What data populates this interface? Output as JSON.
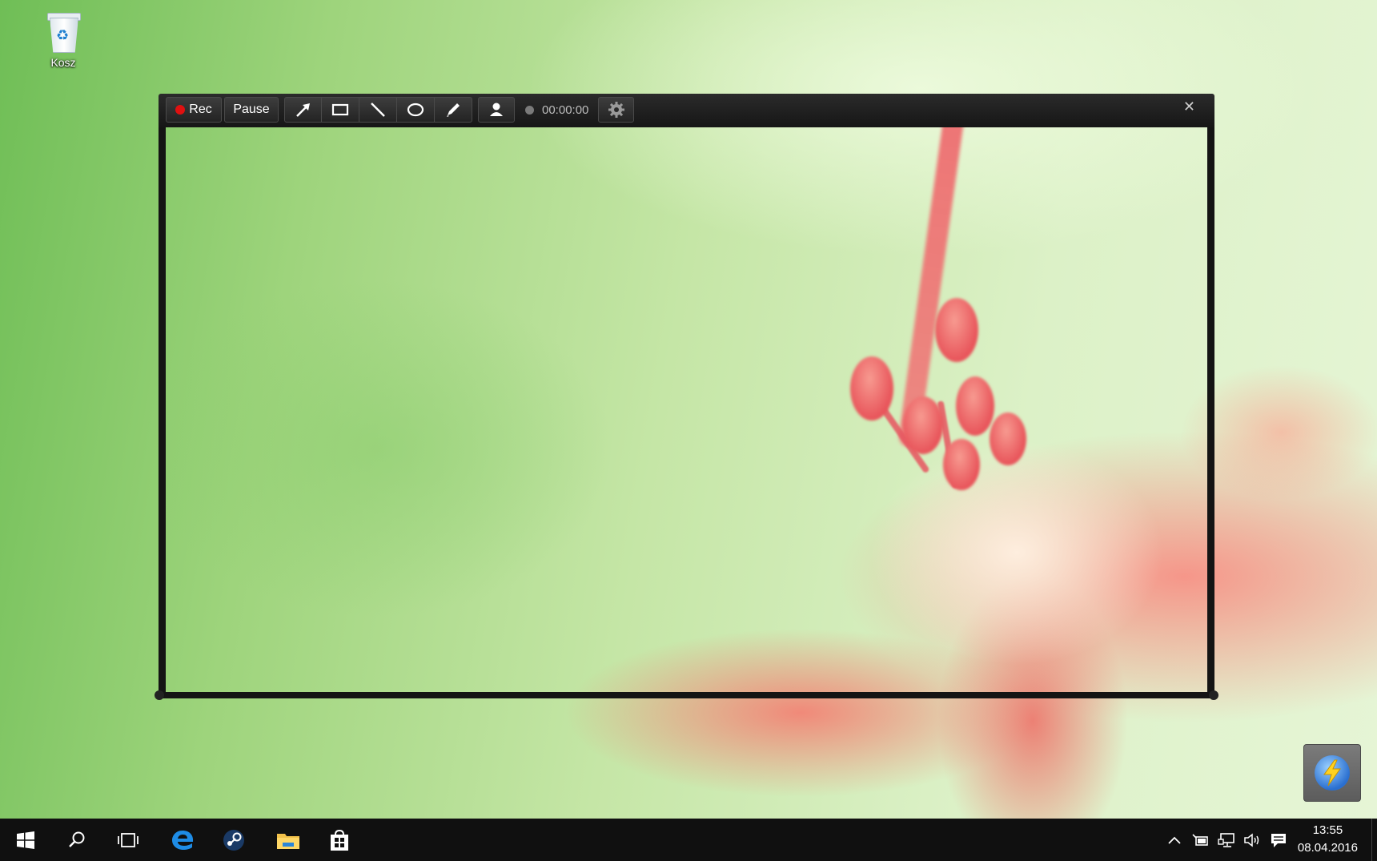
{
  "desktop": {
    "icons": [
      {
        "label": "Kosz",
        "icon": "recycle-bin-icon"
      }
    ]
  },
  "recorder": {
    "rec_label": "Rec",
    "pause_label": "Pause",
    "tools": [
      "arrow-tool-icon",
      "rectangle-tool-icon",
      "line-tool-icon",
      "ellipse-tool-icon",
      "pencil-tool-icon"
    ],
    "webcam_icon": "user-icon",
    "timer": "00:00:00",
    "settings_icon": "gear-icon",
    "close_symbol": "✕",
    "colors": {
      "frame": "#141414",
      "rec_dot": "#e01010"
    }
  },
  "taskbar": {
    "pinned": [
      "windows-start-icon",
      "search-icon",
      "task-view-icon",
      "edge-icon",
      "steam-icon",
      "file-explorer-icon",
      "store-icon"
    ],
    "tray_icons": [
      "chevron-up-icon",
      "battery-icon",
      "network-icon",
      "volume-icon",
      "action-center-icon"
    ],
    "time": "13:55",
    "date": "08.04.2016"
  }
}
